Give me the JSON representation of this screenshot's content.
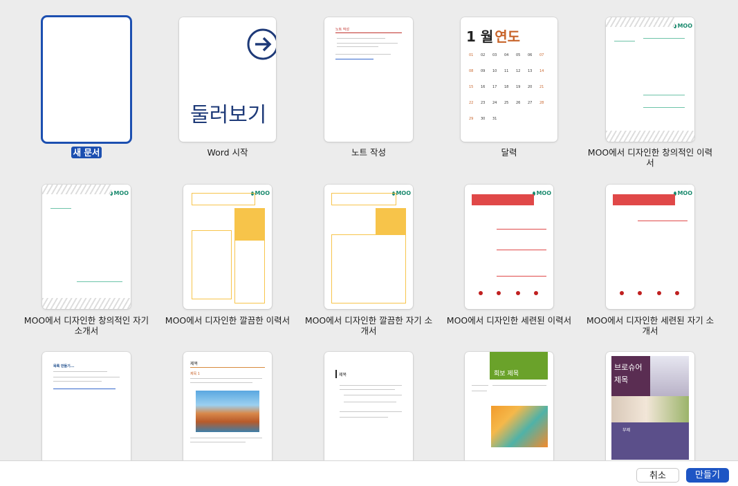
{
  "templates": [
    {
      "name": "새 문서"
    },
    {
      "name": "Word 시작",
      "thumb_text": "둘러보기"
    },
    {
      "name": "노트 작성",
      "thumb_title": "노트 작성"
    },
    {
      "name": "달력",
      "thumb_month": "1 월",
      "thumb_year": "연도"
    },
    {
      "name": "MOO에서 디자인한 창의적인 이력서"
    },
    {
      "name": "MOO에서 디자인한 창의적인 자기 소개서"
    },
    {
      "name": "MOO에서 디자인한 깔끔한 이력서"
    },
    {
      "name": "MOO에서 디자인한 깔끔한 자기 소개서"
    },
    {
      "name": "MOO에서 디자인한 세련된 이력서"
    },
    {
      "name": "MOO에서 디자인한 세련된 자기 소개서"
    },
    {
      "name": "",
      "thumb_title": "목록 만들기..."
    },
    {
      "name": "",
      "thumb_title": "제목",
      "thumb_sub": "제목 1"
    },
    {
      "name": "",
      "thumb_title": "제목"
    },
    {
      "name": "",
      "thumb_title": "회보 제목"
    },
    {
      "name": "",
      "thumb_title": "브로슈어 제목",
      "thumb_sub": "부제"
    }
  ],
  "moo_badge": "MOO",
  "cal_days": [
    "01",
    "02",
    "03",
    "04",
    "05",
    "06",
    "07",
    "08",
    "09",
    "10",
    "11",
    "12",
    "13",
    "14",
    "15",
    "16",
    "17",
    "18",
    "19",
    "20",
    "21",
    "22",
    "23",
    "24",
    "25",
    "26",
    "27",
    "28",
    "29",
    "30",
    "31"
  ],
  "buttons": {
    "cancel": "취소",
    "create": "만들기"
  },
  "colors": {
    "accent": "#1c4fb0",
    "calendar_year": "#c8642a",
    "red": "#e04848",
    "yellow": "#f7c44a",
    "green": "#6aa22a",
    "purple": "#5b4f8a"
  }
}
